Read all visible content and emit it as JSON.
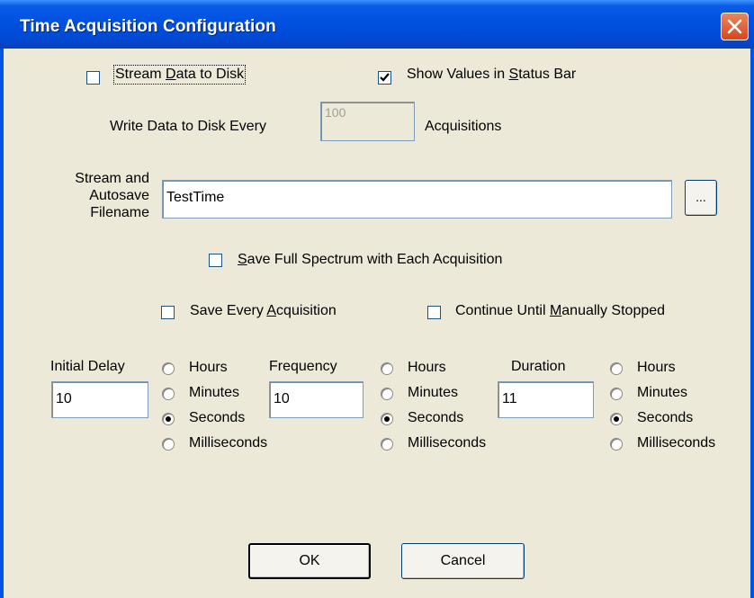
{
  "window": {
    "title": "Time Acquisition Configuration",
    "close_icon": "close-icon"
  },
  "stream_data_to_disk": {
    "label_pre": "Stream ",
    "label_acc": "D",
    "label_post": "ata to Disk",
    "checked": false
  },
  "show_values_status_bar": {
    "label_pre": "Show Values in ",
    "label_acc": "S",
    "label_post": "tatus Bar",
    "checked": true
  },
  "write_every": {
    "label": "Write Data to Disk Every",
    "value": "100",
    "suffix": "Acquisitions"
  },
  "filename": {
    "label_line1": "Stream and",
    "label_line2": "Autosave",
    "label_line3": "Filename",
    "value": "TestTime",
    "browse_label": "..."
  },
  "save_full_spectrum": {
    "label_pre": "",
    "label_acc": "S",
    "label_post": "ave Full Spectrum with Each Acquisition",
    "checked": false
  },
  "save_every_acquisition": {
    "label_pre": "Save Every ",
    "label_acc": "A",
    "label_post": "cquisition",
    "checked": false
  },
  "continue_until_stopped": {
    "label_pre": "Continue Until ",
    "label_acc": "M",
    "label_post": "anually Stopped",
    "checked": false
  },
  "groups": [
    {
      "label": "Initial Delay",
      "value": "10",
      "options": [
        "Hours",
        "Minutes",
        "Seconds",
        "Milliseconds"
      ],
      "selected": "Seconds"
    },
    {
      "label": "Frequency",
      "value": "10",
      "options": [
        "Hours",
        "Minutes",
        "Seconds",
        "Milliseconds"
      ],
      "selected": "Seconds"
    },
    {
      "label": "Duration",
      "value": "11",
      "options": [
        "Hours",
        "Minutes",
        "Seconds",
        "Milliseconds"
      ],
      "selected": "Seconds"
    }
  ],
  "buttons": {
    "ok": "OK",
    "cancel": "Cancel"
  },
  "colors": {
    "titlebar": "#0054e3",
    "dialog_bg": "#ece9d8",
    "close_button": "#d5471f"
  }
}
